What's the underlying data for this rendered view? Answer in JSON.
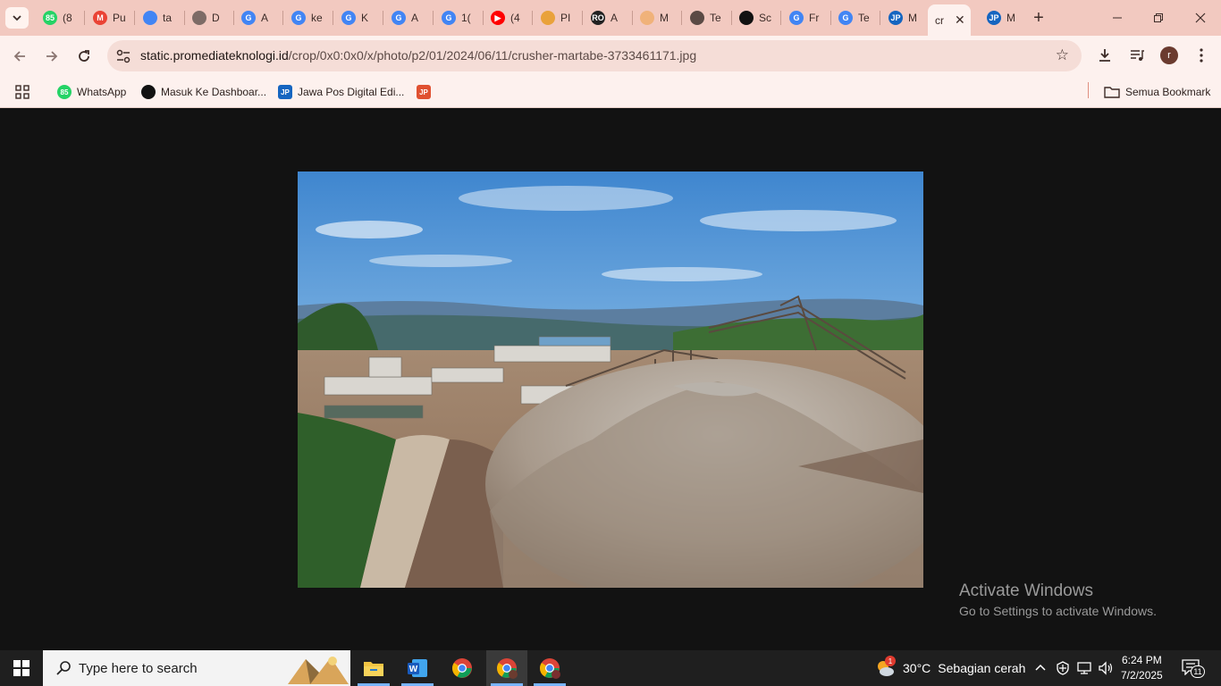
{
  "tabs": [
    {
      "label": "(8",
      "favicon": "whatsapp-icon",
      "badge": "85",
      "color": "#25d366"
    },
    {
      "label": "Pu",
      "favicon": "gmail-icon",
      "badge": "M",
      "color": "#ea4335"
    },
    {
      "label": "ta",
      "favicon": "docs-icon",
      "badge": "",
      "color": "#4285f4"
    },
    {
      "label": "D",
      "favicon": "globe-icon",
      "badge": "",
      "color": "#7d6b66"
    },
    {
      "label": "A",
      "favicon": "google-icon",
      "badge": "G",
      "color": "#4285f4"
    },
    {
      "label": "ke",
      "favicon": "google-icon",
      "badge": "G",
      "color": "#4285f4"
    },
    {
      "label": "K",
      "favicon": "google-icon",
      "badge": "G",
      "color": "#4285f4"
    },
    {
      "label": "A",
      "favicon": "google-icon",
      "badge": "G",
      "color": "#4285f4"
    },
    {
      "label": "1(",
      "favicon": "google-icon",
      "badge": "G",
      "color": "#4285f4"
    },
    {
      "label": "(4",
      "favicon": "youtube-icon",
      "badge": "▶",
      "color": "#ff0000"
    },
    {
      "label": "PI",
      "favicon": "shield-icon",
      "badge": "",
      "color": "#e9a23b"
    },
    {
      "label": "A",
      "favicon": "ro-icon",
      "badge": "RO",
      "color": "#222222"
    },
    {
      "label": "M",
      "favicon": "hand-icon",
      "badge": "",
      "color": "#f0b27a"
    },
    {
      "label": "Te",
      "favicon": "globe-icon",
      "badge": "",
      "color": "#5b4a45"
    },
    {
      "label": "Sc",
      "favicon": "openai-icon",
      "badge": "",
      "color": "#111111"
    },
    {
      "label": "Fr",
      "favicon": "google-icon",
      "badge": "G",
      "color": "#4285f4"
    },
    {
      "label": "Te",
      "favicon": "google-icon",
      "badge": "G",
      "color": "#4285f4"
    },
    {
      "label": "M",
      "favicon": "jp-icon",
      "badge": "JP",
      "color": "#1565c0"
    },
    {
      "label": "cr",
      "favicon": "",
      "badge": "",
      "color": "#fdf1ee",
      "active": true
    },
    {
      "label": "M",
      "favicon": "jp-icon",
      "badge": "JP",
      "color": "#1565c0"
    }
  ],
  "address": {
    "host": "static.promediateknologi.id",
    "path": "/crop/0x0:0x0/x/photo/p2/01/2024/06/11/crusher-martabe-3733461171.jpg"
  },
  "bookmarks": [
    {
      "label": "WhatsApp",
      "icon": "whatsapp-icon",
      "badge": "85",
      "color": "#25d366"
    },
    {
      "label": "Masuk Ke Dashboar...",
      "icon": "github-icon",
      "badge": "",
      "color": "#111111"
    },
    {
      "label": "Jawa Pos Digital Edi...",
      "icon": "jp-icon",
      "badge": "JP",
      "color": "#1565c0"
    },
    {
      "label": "",
      "icon": "jp-small-icon",
      "badge": "JP",
      "color": "#e05030"
    }
  ],
  "all_bookmarks_label": "Semua Bookmark",
  "avatar_initial": "r",
  "activate": {
    "heading": "Activate Windows",
    "sub": "Go to Settings to activate Windows."
  },
  "taskbar": {
    "search_placeholder": "Type here to search",
    "weather_temp": "30°C",
    "weather_desc": "Sebagian cerah",
    "weather_badge": "1",
    "time": "6:24 PM",
    "date": "7/2/2025",
    "notification_count": "11"
  }
}
